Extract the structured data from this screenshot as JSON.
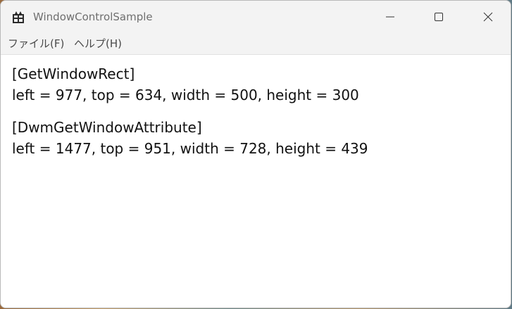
{
  "window": {
    "title": "WindowControlSample"
  },
  "menu": {
    "items": [
      {
        "label": "ファイル(F)"
      },
      {
        "label": "ヘルプ(H)"
      }
    ]
  },
  "content": {
    "blocks": [
      {
        "header": "[GetWindowRect]",
        "values": "left = 977, top = 634, width = 500, height = 300"
      },
      {
        "header": "[DwmGetWindowAttribute]",
        "values": "left = 1477, top = 951, width = 728, height = 439"
      }
    ]
  },
  "icons": {
    "app": "app-icon",
    "minimize": "minimize-icon",
    "maximize": "maximize-icon",
    "close": "close-icon"
  },
  "colors": {
    "titlebar": "#f3f3f3",
    "title_text": "#6f6f6f",
    "content_bg": "#ffffff",
    "content_text": "#111111"
  }
}
